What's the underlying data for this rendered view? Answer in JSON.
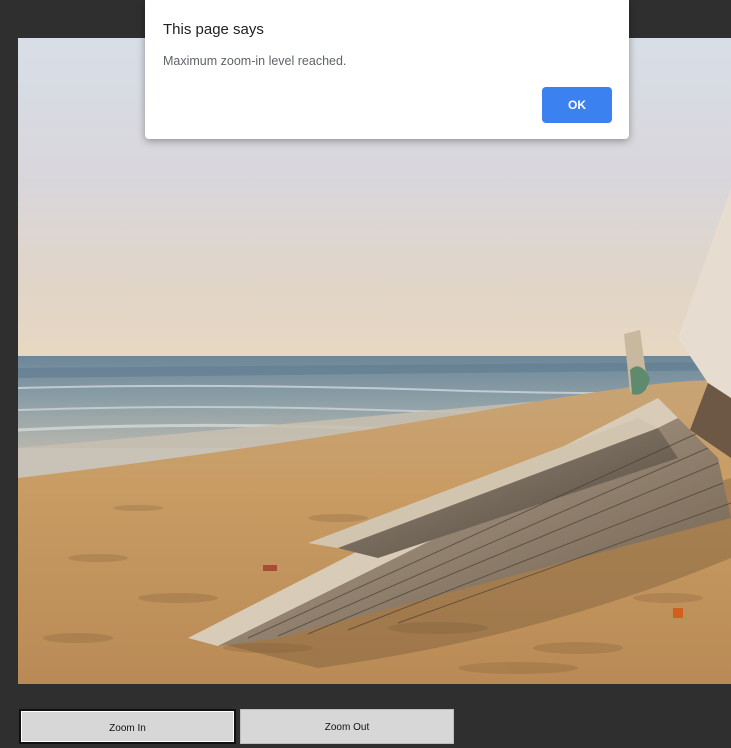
{
  "dialog": {
    "title": "This page says",
    "message": "Maximum zoom-in level reached.",
    "ok_label": "OK"
  },
  "controls": {
    "zoom_in_label": "Zoom In",
    "zoom_out_label": "Zoom Out"
  },
  "image": {
    "subject": "beach-with-wooden-boat"
  }
}
